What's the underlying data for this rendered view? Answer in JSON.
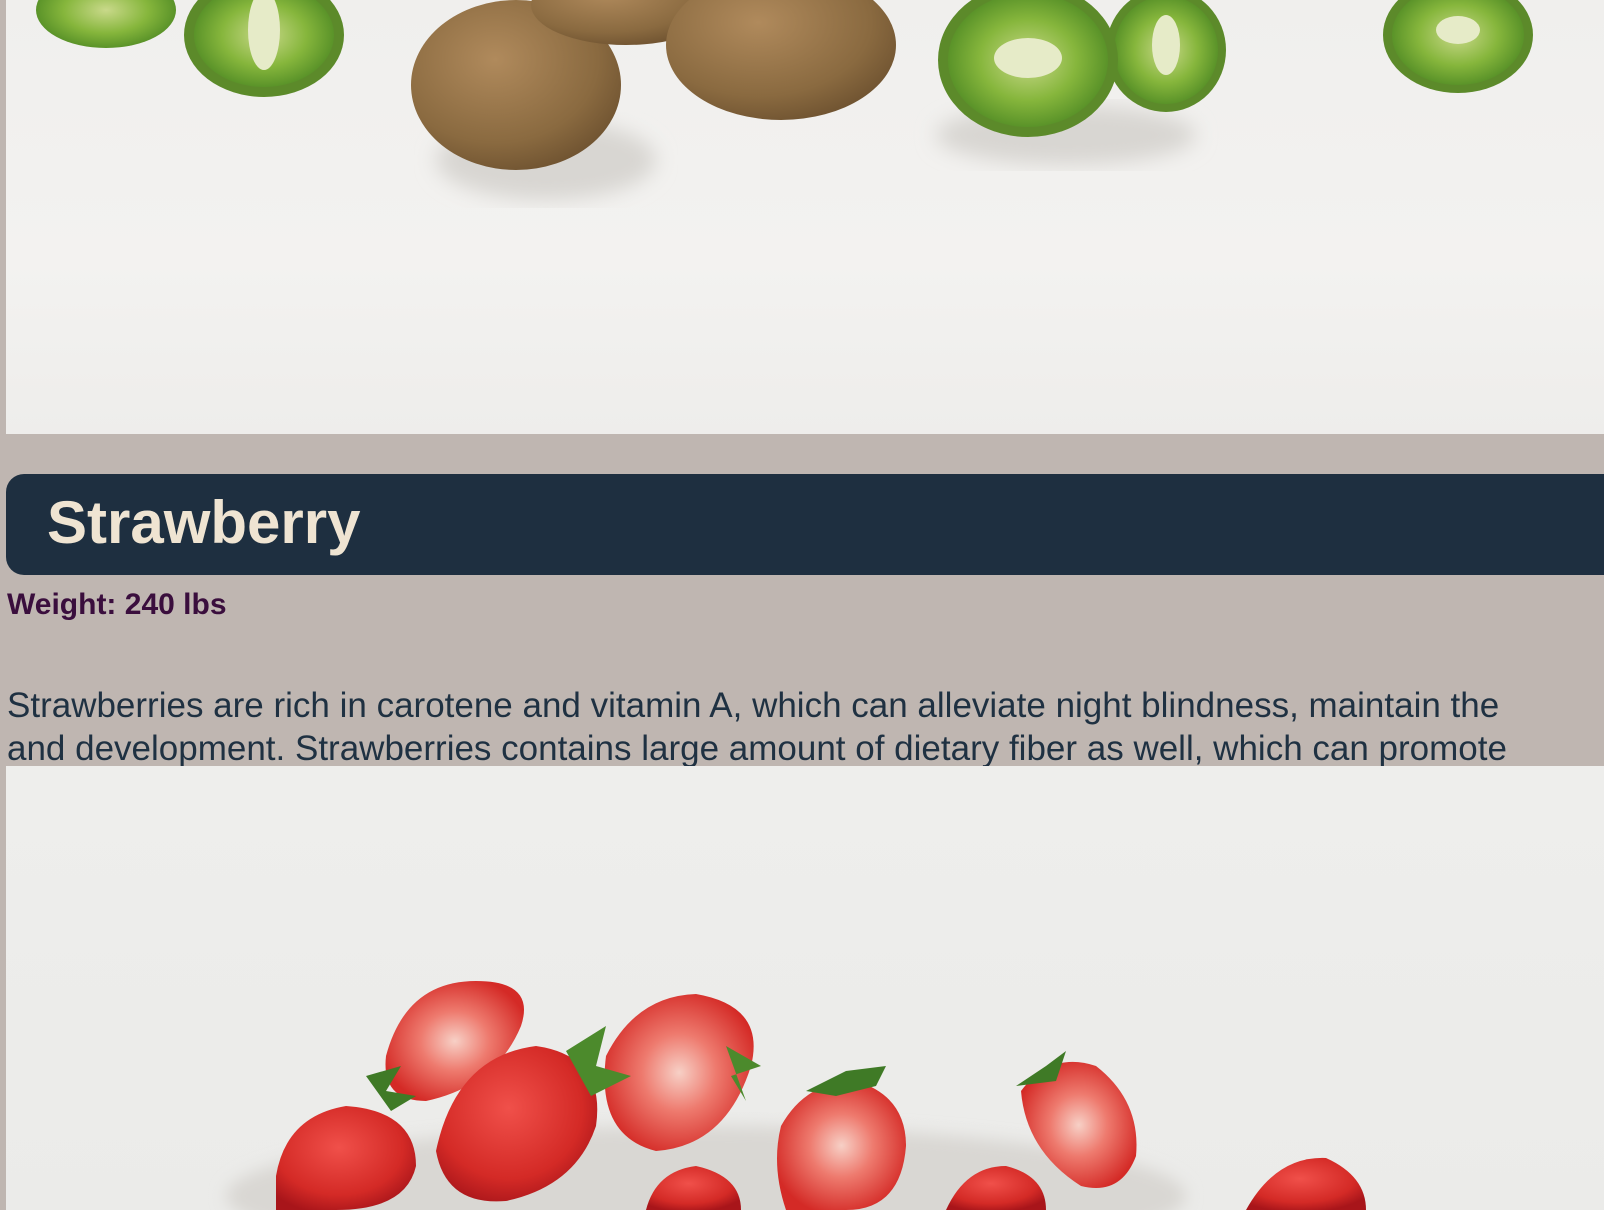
{
  "item": {
    "title": "Strawberry",
    "weight_label": "Weight:",
    "weight_value": "240 lbs",
    "description_lines": [
      "Strawberries are rich in carotene and vitamin A, which can alleviate night blindness, maintain the",
      "and development. Strawberries contains large amount of dietary fiber as well, which can promote"
    ]
  },
  "colors": {
    "page_background": "#bfb6b1",
    "title_bar": "#1e2f40",
    "title_text": "#efe4d2",
    "weight_text": "#3a0e3d",
    "description_text": "#1f3142"
  }
}
